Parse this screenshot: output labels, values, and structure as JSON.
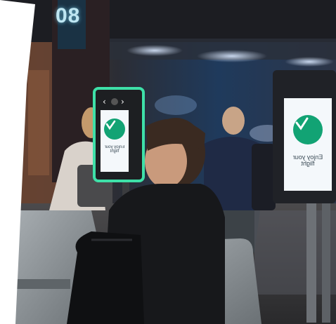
{
  "photo": {
    "gate_number": "08",
    "kiosk_screen_text": "Enjoy your flight",
    "large_screen_text": "Enjoy your flight",
    "colors": {
      "kiosk_glow": "#3ee0a8",
      "check_circle": "#12a374",
      "screen_bg": "#f4f8fb",
      "wall": "#23262d",
      "floor": "#3a3b3f",
      "turnstile": "#8d9397"
    },
    "icons": [
      "check-icon",
      "chevron-left-icon",
      "chevron-right-icon"
    ]
  }
}
